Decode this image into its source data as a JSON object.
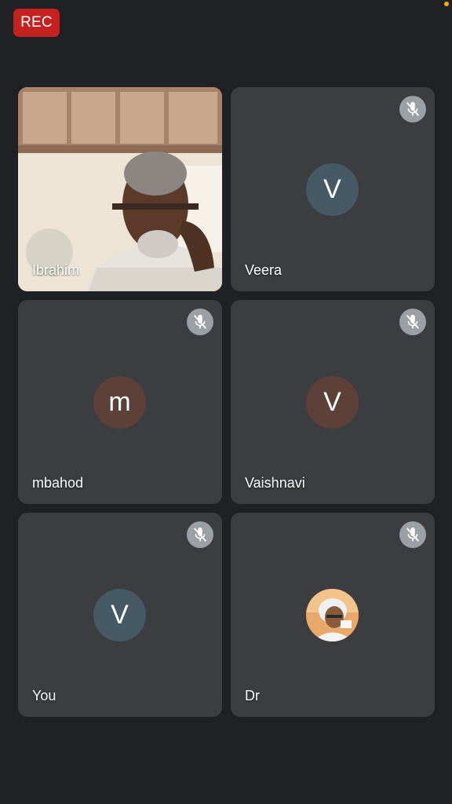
{
  "recording": {
    "label": "REC"
  },
  "tiles": [
    {
      "name": "Ibrahim",
      "type": "video",
      "muted": false
    },
    {
      "name": "Veera",
      "initial": "V",
      "avatar_color": "#455a64",
      "muted": true
    },
    {
      "name": "mbahod",
      "initial": "m",
      "avatar_color": "#5d4037",
      "muted": true
    },
    {
      "name": "Vaishnavi",
      "initial": "V",
      "avatar_color": "#5d4037",
      "muted": true
    },
    {
      "name": "You",
      "initial": "V",
      "avatar_color": "#455a64",
      "muted": true
    },
    {
      "name": "Dr",
      "type": "photo-avatar",
      "muted": true
    }
  ],
  "icons": {
    "mute": "mic-off-icon"
  },
  "colors": {
    "background": "#202124",
    "tile": "#3c3d40",
    "rec": "#c5221f"
  }
}
